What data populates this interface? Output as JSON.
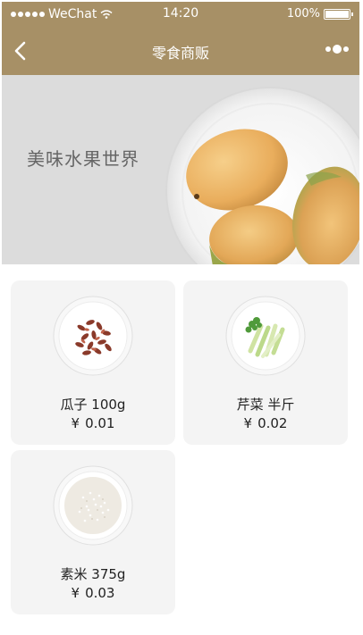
{
  "status_bar": {
    "carrier": "WeChat",
    "time": "14:20",
    "battery": "100%",
    "battery_level": 1.0,
    "icons": [
      "signal-dots-icon",
      "wifi-icon",
      "battery-icon"
    ]
  },
  "nav": {
    "title": "零食商贩",
    "back_icon": "chevron-left-icon",
    "more_icon": "more-dots-icon"
  },
  "banner": {
    "text": "美味水果世界"
  },
  "products": [
    {
      "name": "瓜子 100g",
      "currency": "¥",
      "price": "0.01",
      "icon": "melon-seeds-plate"
    },
    {
      "name": "芹菜 半斤",
      "currency": "¥",
      "price": "0.02",
      "icon": "celery-plate"
    },
    {
      "name": "素米 375g",
      "currency": "¥",
      "price": "0.03",
      "icon": "rice-plate"
    }
  ],
  "colors": {
    "header": "#a79066",
    "banner_bg": "#dcdcdc",
    "card_bg": "#f4f4f4"
  }
}
